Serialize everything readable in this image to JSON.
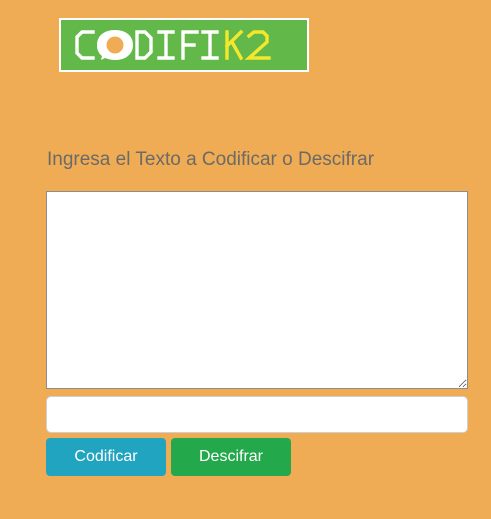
{
  "logo": {
    "text_main": "CODIFI",
    "text_accent": "K2",
    "background_color": "#62b94a",
    "main_text_color": "#ffffff",
    "accent_text_color": "#f5e72c",
    "icon": "speech-bubble-icon"
  },
  "prompt": {
    "text": "Ingresa el Texto a Codificar o Descifrar"
  },
  "input": {
    "value": "",
    "placeholder": ""
  },
  "output": {
    "value": ""
  },
  "buttons": {
    "encode_label": "Codificar",
    "decode_label": "Descifrar",
    "encode_color": "#20a4bf",
    "decode_color": "#23a84b"
  },
  "colors": {
    "page_background": "#efac55",
    "prompt_text": "#6c6a66"
  }
}
